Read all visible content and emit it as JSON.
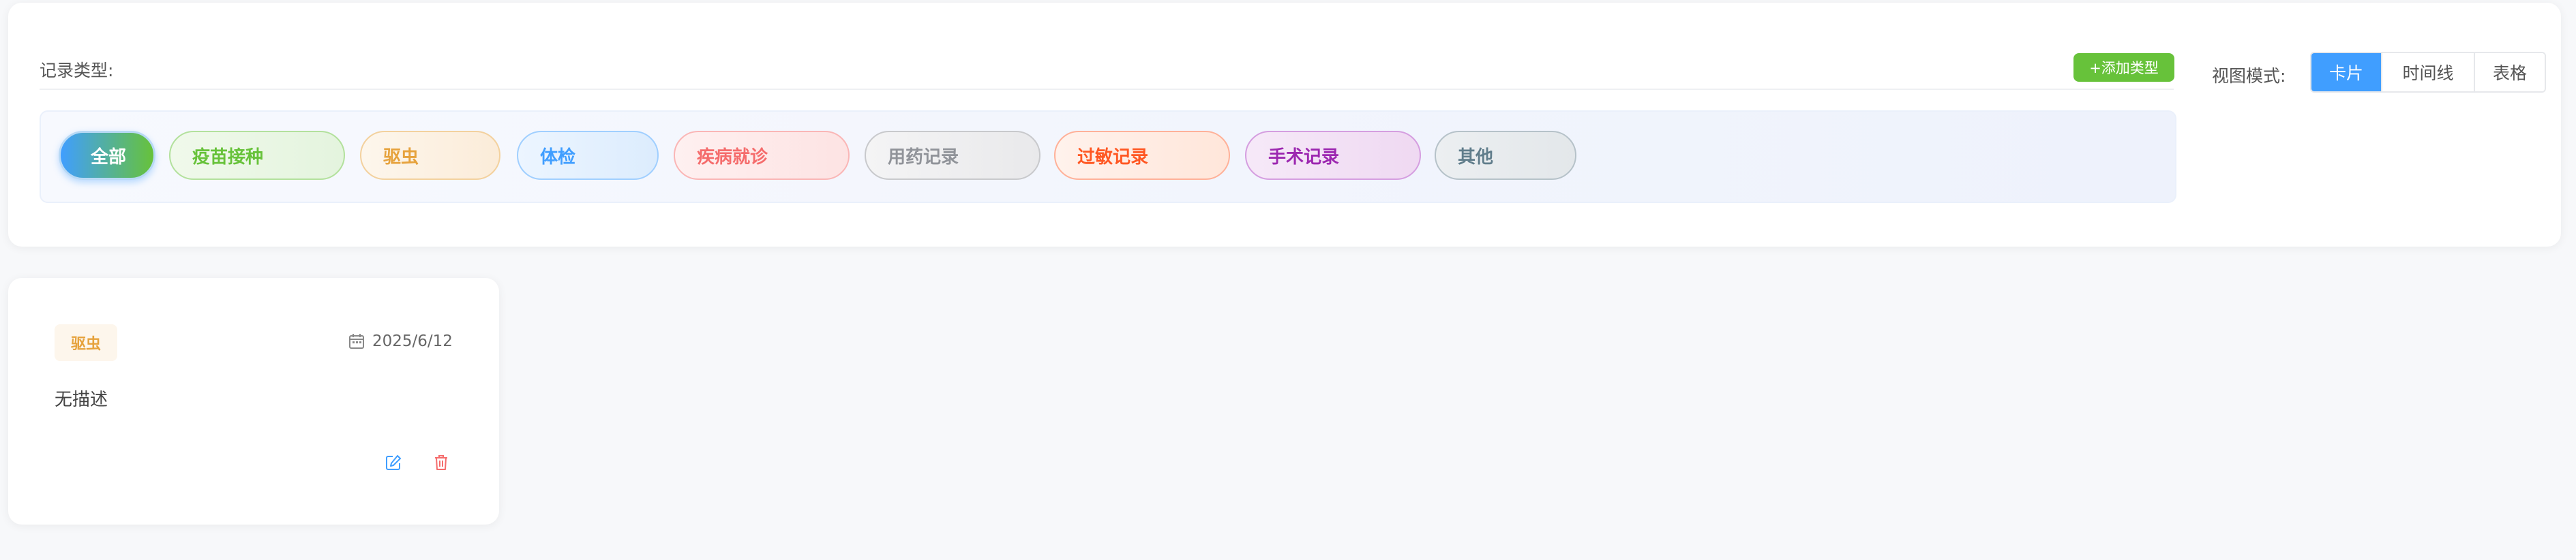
{
  "filter": {
    "record_type_label": "记录类型:",
    "add_type_button": "+添加类型",
    "view_mode_label": "视图模式:",
    "view_modes": [
      {
        "label": "卡片",
        "active": true
      },
      {
        "label": "时间线",
        "active": false
      },
      {
        "label": "表格",
        "active": false
      }
    ],
    "chips": [
      {
        "label": "全部",
        "active": true
      },
      {
        "label": "疫苗接种",
        "active": false
      },
      {
        "label": "驱虫",
        "active": false
      },
      {
        "label": "体检",
        "active": false
      },
      {
        "label": "疾病就诊",
        "active": false
      },
      {
        "label": "用药记录",
        "active": false
      },
      {
        "label": "过敏记录",
        "active": false
      },
      {
        "label": "手术记录",
        "active": false
      },
      {
        "label": "其他",
        "active": false
      }
    ]
  },
  "records": [
    {
      "type": "驱虫",
      "date": "2025/6/12",
      "description": "无描述",
      "icons": {
        "date": "calendar-icon",
        "edit": "edit-icon",
        "delete": "trash-icon"
      }
    }
  ],
  "colors": {
    "primary": "#409eff",
    "success": "#67c23a",
    "warning": "#e6a23c",
    "danger": "#f56c6c"
  }
}
